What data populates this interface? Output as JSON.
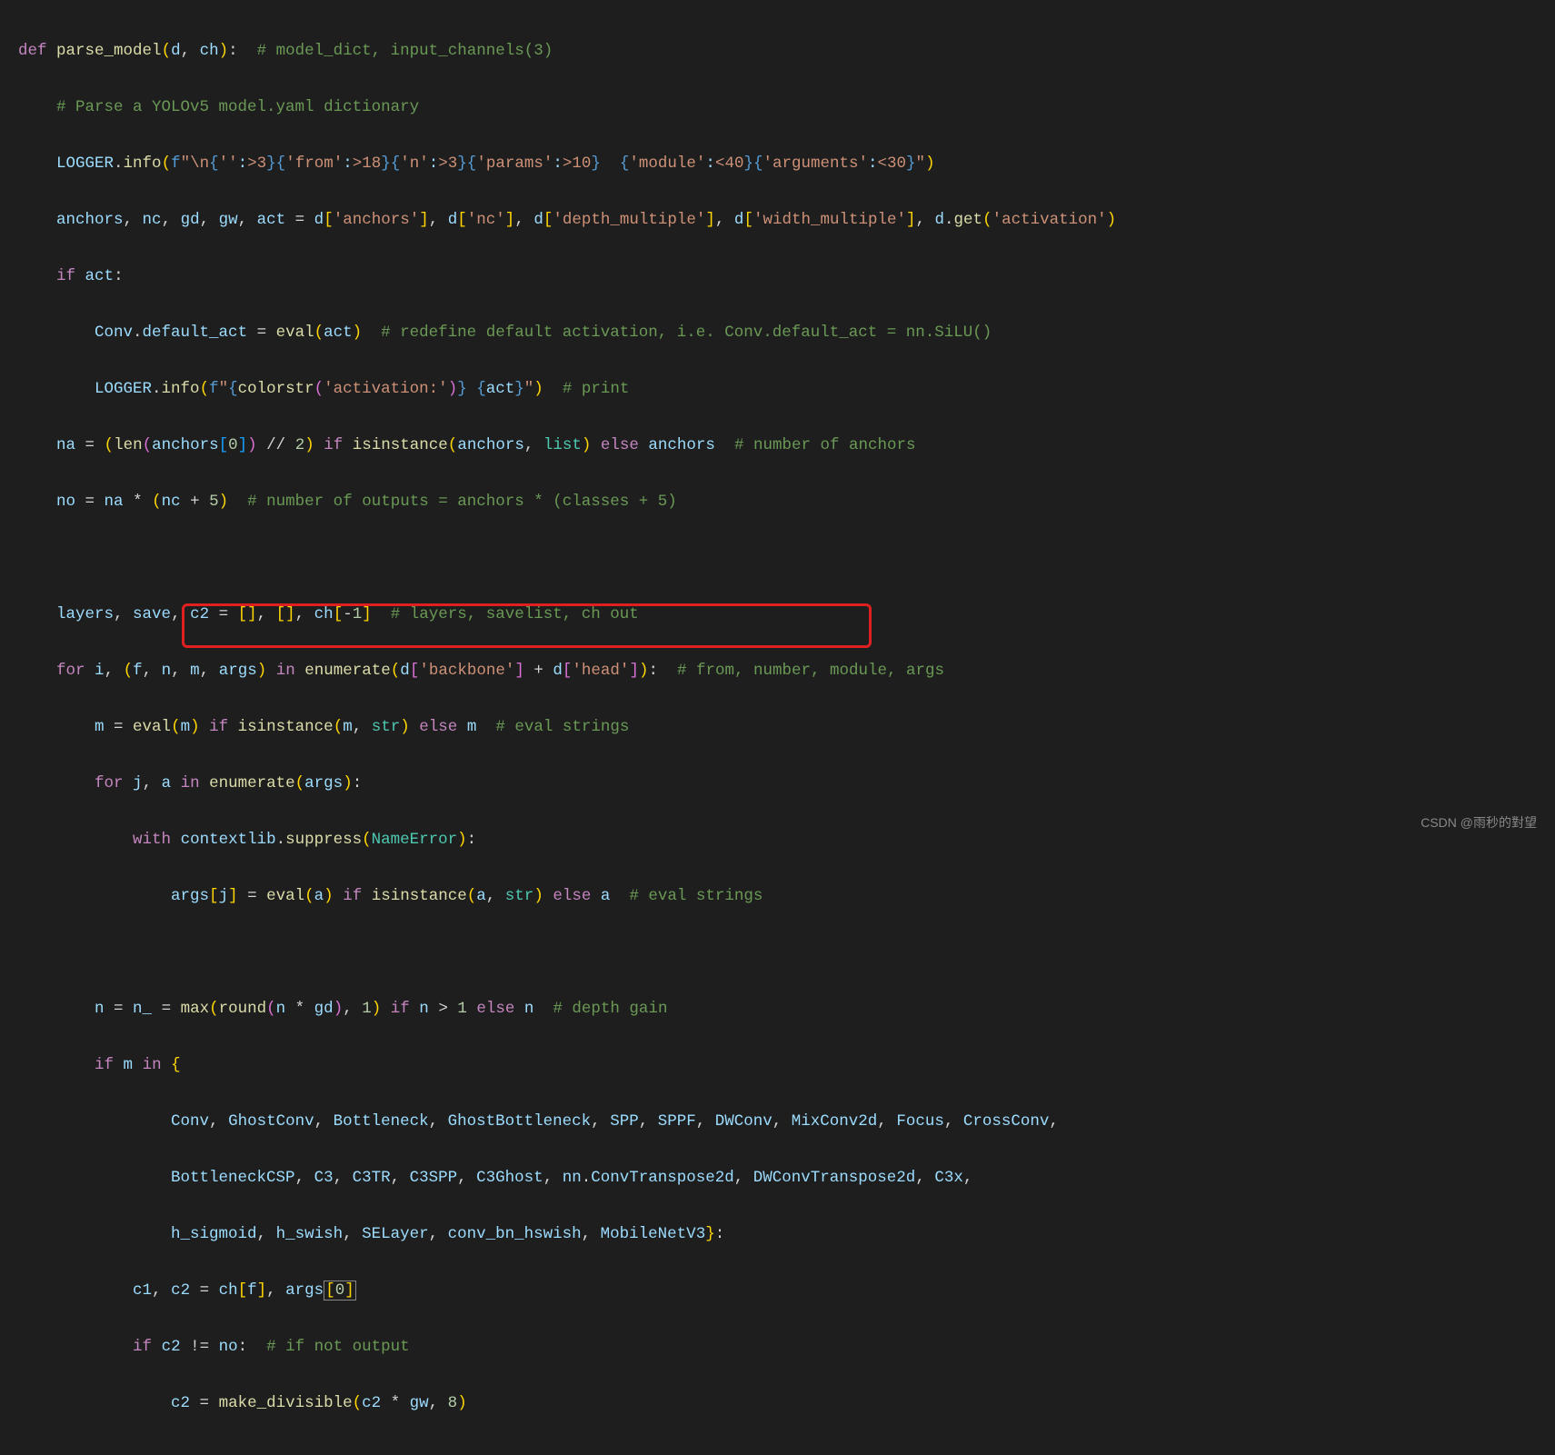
{
  "code": {
    "l1_def": "def",
    "l1_fn": "parse_model",
    "l1_params": "(",
    "l1_p1": "d",
    "l1_p2": "ch",
    "l1_end": "):",
    "l1_cmt": "# model_dict, input_channels(3)",
    "l2_cmt": "# Parse a YOLOv5 model.yaml dictionary",
    "l3_logger": "LOGGER",
    "l3_info": "info",
    "l3_f": "f",
    "l3_str1": "\"\\n",
    "l3_s1": "{",
    "l3_s1a": "''",
    "l3_s1b": ":>3",
    "l3_s2": "}{",
    "l3_s2a": "'from'",
    "l3_s2b": ":>18",
    "l3_s3": "}{",
    "l3_s3a": "'n'",
    "l3_s3b": ":>3",
    "l3_s4": "}{",
    "l3_s4a": "'params'",
    "l3_s4b": ":>10",
    "l3_s5": "}",
    "l3_gap": "  ",
    "l3_s6": "{",
    "l3_s6a": "'module'",
    "l3_s6b": ":<40",
    "l3_s7": "}{",
    "l3_s7a": "'arguments'",
    "l3_s7b": ":<30",
    "l3_s8": "}",
    "l3_end": "\"",
    "l4_vars": "anchors",
    "l4_nc": "nc",
    "l4_gd": "gd",
    "l4_gw": "gw",
    "l4_act": "act",
    "l4_d": "d",
    "l4_k1": "'anchors'",
    "l4_k2": "'nc'",
    "l4_k3": "'depth_multiple'",
    "l4_k4": "'width_multiple'",
    "l4_get": "get",
    "l4_k5": "'activation'",
    "l5_if": "if",
    "l5_act": "act",
    "l6_conv": "Conv",
    "l6_da": "default_act",
    "l6_eval": "eval",
    "l6_act": "act",
    "l6_cmt": "# redefine default activation, i.e. Conv.default_act = nn.SiLU()",
    "l7_logger": "LOGGER",
    "l7_info": "info",
    "l7_colorstr": "colorstr",
    "l7_s1": "'activation:'",
    "l7_act": "act",
    "l7_cmt": "# print",
    "l8_na": "na",
    "l8_len": "len",
    "l8_anchors": "anchors",
    "l8_0": "0",
    "l8_2": "2",
    "l8_if": "if",
    "l8_isinst": "isinstance",
    "l8_list": "list",
    "l8_else": "else",
    "l8_cmt": "# number of anchors",
    "l9_no": "no",
    "l9_na": "na",
    "l9_nc": "nc",
    "l9_5": "5",
    "l9_cmt": "# number of outputs = anchors * (classes + 5)",
    "l11_layers": "layers",
    "l11_save": "save",
    "l11_c2": "c2",
    "l11_ch": "ch",
    "l11_cmt": "# layers, savelist, ch out",
    "l12_for": "for",
    "l12_i": "i",
    "l12_f": "f",
    "l12_n": "n",
    "l12_m": "m",
    "l12_args": "args",
    "l12_in": "in",
    "l12_enum": "enumerate",
    "l12_d": "d",
    "l12_bb": "'backbone'",
    "l12_head": "'head'",
    "l12_cmt": "# from, number, module, args",
    "l13_m": "m",
    "l13_eval": "eval",
    "l13_if": "if",
    "l13_isinst": "isinstance",
    "l13_str": "str",
    "l13_else": "else",
    "l13_cmt": "# eval strings",
    "l14_for": "for",
    "l14_j": "j",
    "l14_a": "a",
    "l14_in": "in",
    "l14_enum": "enumerate",
    "l14_args": "args",
    "l15_with": "with",
    "l15_ctx": "contextlib",
    "l15_sup": "suppress",
    "l15_ne": "NameError",
    "l16_args": "args",
    "l16_j": "j",
    "l16_eval": "eval",
    "l16_a": "a",
    "l16_if": "if",
    "l16_isinst": "isinstance",
    "l16_str": "str",
    "l16_else": "else",
    "l16_cmt": "# eval strings",
    "l18_n": "n",
    "l18_n_": "n_",
    "l18_max": "max",
    "l18_round": "round",
    "l18_gd": "gd",
    "l18_1": "1",
    "l18_if": "if",
    "l18_else": "else",
    "l18_cmt": "# depth gain",
    "l19_if": "if",
    "l19_m": "m",
    "l19_in": "in",
    "l20a": "Conv",
    "l20b": "GhostConv",
    "l20c": "Bottleneck",
    "l20d": "GhostBottleneck",
    "l20e": "SPP",
    "l20f": "SPPF",
    "l20g": "DWConv",
    "l20h": "MixConv2d",
    "l20i": "Focus",
    "l20j": "CrossConv",
    "l21a": "BottleneckCSP",
    "l21b": "C3",
    "l21c": "C3TR",
    "l21d": "C3SPP",
    "l21e": "C3Ghost",
    "l21f": "nn",
    "l21g": "ConvTranspose2d",
    "l21h": "DWConvTranspose2d",
    "l21i": "C3x",
    "l22a": "h_sigmoid",
    "l22b": "h_swish",
    "l22c": "SELayer",
    "l22d": "conv_bn_hswish",
    "l22e": "MobileNetV3",
    "l23_c1": "c1",
    "l23_c2": "c2",
    "l23_ch": "ch",
    "l23_f": "f",
    "l23_args": "args",
    "l23_0": "0",
    "l24_if": "if",
    "l24_c2": "c2",
    "l24_no": "no",
    "l24_cmt": "# if not output",
    "l25_c2": "c2",
    "l25_md": "make_divisible",
    "l25_gw": "gw",
    "l25_8": "8"
  },
  "watermark": "CSDN @雨秒的對望"
}
